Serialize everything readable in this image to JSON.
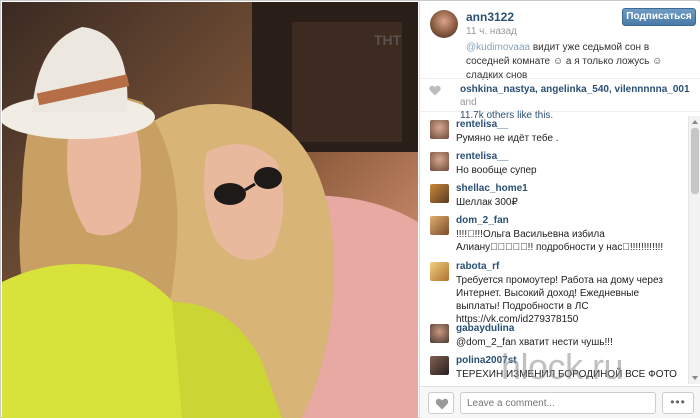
{
  "post": {
    "username": "ann3122",
    "time_ago": "11 ч. назад",
    "follow_label": "Подписаться",
    "caption_mention": "@kudimovaaa",
    "caption_text": " видит уже седьмой сон в соседней комнате ☺ а я только ложусь ☺ сладких снов",
    "photo_logo": "ТНТ"
  },
  "likes": {
    "users": "oshkina_nastya, angelinka_540, vilennnnna_001",
    "and": "and",
    "count_text": "11.7k others like this."
  },
  "comments": [
    {
      "user": "rentelisa__",
      "text": "Румяно не идёт тебе ."
    },
    {
      "user": "rentelisa__",
      "text": "Но вообще супер"
    },
    {
      "user": "shellac_home1",
      "text": "Шеллак 300₽"
    },
    {
      "user": "dom_2_fan",
      "text": "!!!!⃣!!!Ольга Васильевна избила Алиану⃣⃣⃣⃣⃣!! подробности у нас⃣!!!!!!!!!!!!"
    },
    {
      "user": "rabota_rf",
      "text": "Требуется промоутер! Работа на дому через Интернет. Высокий доход! Ежедневные выплаты! Подробности в ЛС https://vk.com/id279378150"
    },
    {
      "user": "gabaydulina",
      "text": "@dom_2_fan хватит нести чушь!!!"
    },
    {
      "user": "polina2007st",
      "text": "ТЕРЕХИН ИЗМЕНИЛ БОРОДИНОЙ ВСЕ ФОТО"
    }
  ],
  "footer": {
    "comment_placeholder": "Leave a comment...",
    "more_label": "•••"
  },
  "watermark": "hlock.ru",
  "colors": {
    "link": "#2b5073",
    "follow_button": "#4a7aa8",
    "mention": "#8aa2b8"
  }
}
